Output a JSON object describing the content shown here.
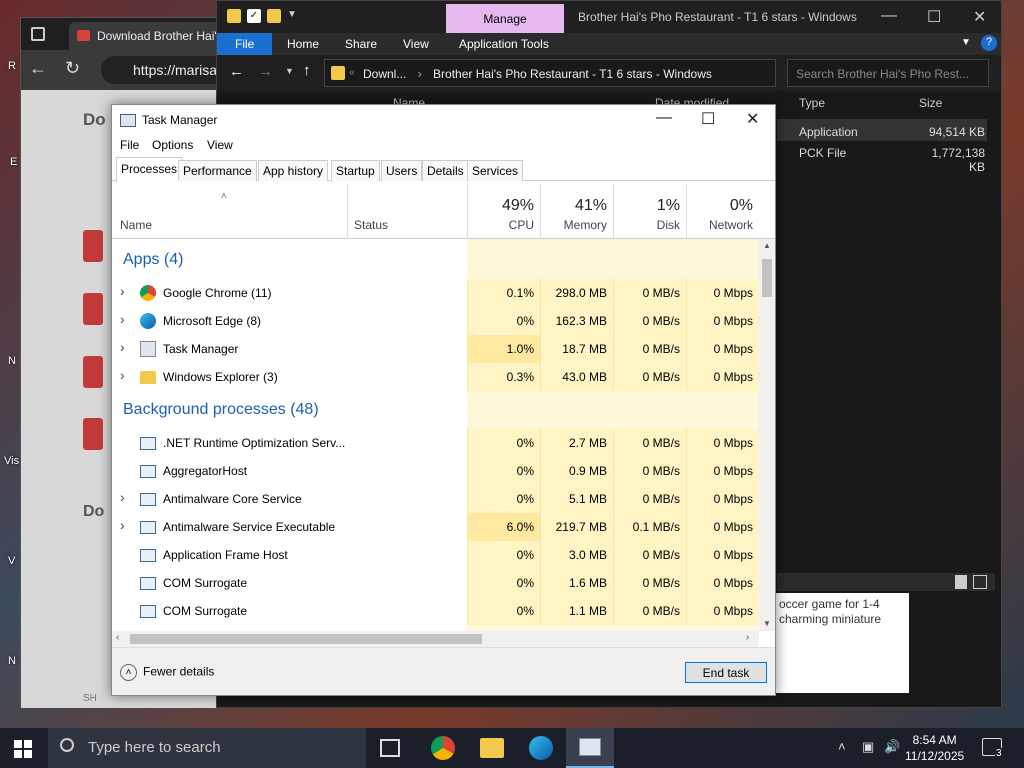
{
  "desktop": {
    "side_labels": [
      "R",
      "E",
      "N",
      "Vis",
      "V",
      "N"
    ]
  },
  "browser": {
    "tab_title": "Download Brother Hai'",
    "url": "https://marisa",
    "page_labels": [
      "Do",
      "Do",
      "SH"
    ]
  },
  "explorer": {
    "manage_tab": "Manage",
    "title": "Brother Hai's Pho Restaurant - T1 6 stars - Windows",
    "ribbon": [
      "File",
      "Home",
      "Share",
      "View",
      "Application Tools"
    ],
    "address": {
      "prefix": "Downl...",
      "path": "Brother Hai's Pho Restaurant - T1 6 stars - Windows"
    },
    "search_placeholder": "Search Brother Hai's Pho Rest...",
    "columns": [
      "Name",
      "Date modified",
      "Type",
      "Size"
    ],
    "rows": [
      {
        "type": "Application",
        "size": "94,514 KB"
      },
      {
        "type": "PCK File",
        "size": "1,772,138 KB"
      }
    ],
    "detail_text": "occer game for 1-4 charming miniature"
  },
  "task_manager": {
    "title": "Task Manager",
    "menu": [
      "File",
      "Options",
      "View"
    ],
    "tabs": [
      "Processes",
      "Performance",
      "App history",
      "Startup",
      "Users",
      "Details",
      "Services"
    ],
    "active_tab": "Processes",
    "columns": {
      "name": "Name",
      "status": "Status",
      "cpu": {
        "pct": "49%",
        "label": "CPU"
      },
      "memory": {
        "pct": "41%",
        "label": "Memory"
      },
      "disk": {
        "pct": "1%",
        "label": "Disk"
      },
      "network": {
        "pct": "0%",
        "label": "Network"
      }
    },
    "groups": {
      "apps": "Apps (4)",
      "background": "Background processes (48)"
    },
    "apps": [
      {
        "name": "Google Chrome (11)",
        "icon": "chrome-icon",
        "cpu": "0.1%",
        "memory": "298.0 MB",
        "disk": "0 MB/s",
        "network": "0 Mbps"
      },
      {
        "name": "Microsoft Edge (8)",
        "icon": "edge-icon",
        "cpu": "0%",
        "memory": "162.3 MB",
        "disk": "0 MB/s",
        "network": "0 Mbps"
      },
      {
        "name": "Task Manager",
        "icon": "task-manager-icon",
        "cpu": "1.0%",
        "memory": "18.7 MB",
        "disk": "0 MB/s",
        "network": "0 Mbps"
      },
      {
        "name": "Windows Explorer (3)",
        "icon": "folder-icon",
        "cpu": "0.3%",
        "memory": "43.0 MB",
        "disk": "0 MB/s",
        "network": "0 Mbps"
      }
    ],
    "background": [
      {
        "name": ".NET Runtime Optimization Serv...",
        "cpu": "0%",
        "memory": "2.7 MB",
        "disk": "0 MB/s",
        "network": "0 Mbps"
      },
      {
        "name": "AggregatorHost",
        "cpu": "0%",
        "memory": "0.9 MB",
        "disk": "0 MB/s",
        "network": "0 Mbps"
      },
      {
        "name": "Antimalware Core Service",
        "cpu": "0%",
        "memory": "5.1 MB",
        "disk": "0 MB/s",
        "network": "0 Mbps"
      },
      {
        "name": "Antimalware Service Executable",
        "cpu": "6.0%",
        "memory": "219.7 MB",
        "disk": "0.1 MB/s",
        "network": "0 Mbps"
      },
      {
        "name": "Application Frame Host",
        "cpu": "0%",
        "memory": "3.0 MB",
        "disk": "0 MB/s",
        "network": "0 Mbps"
      },
      {
        "name": "COM Surrogate",
        "cpu": "0%",
        "memory": "1.6 MB",
        "disk": "0 MB/s",
        "network": "0 Mbps"
      },
      {
        "name": "COM Surrogate",
        "cpu": "0%",
        "memory": "1.1 MB",
        "disk": "0 MB/s",
        "network": "0 Mbps"
      }
    ],
    "fewer_details": "Fewer details",
    "end_task": "End task"
  },
  "taskbar": {
    "search_placeholder": "Type here to search",
    "time": "8:54 AM",
    "date": "11/12/2025",
    "notification_count": "3"
  }
}
